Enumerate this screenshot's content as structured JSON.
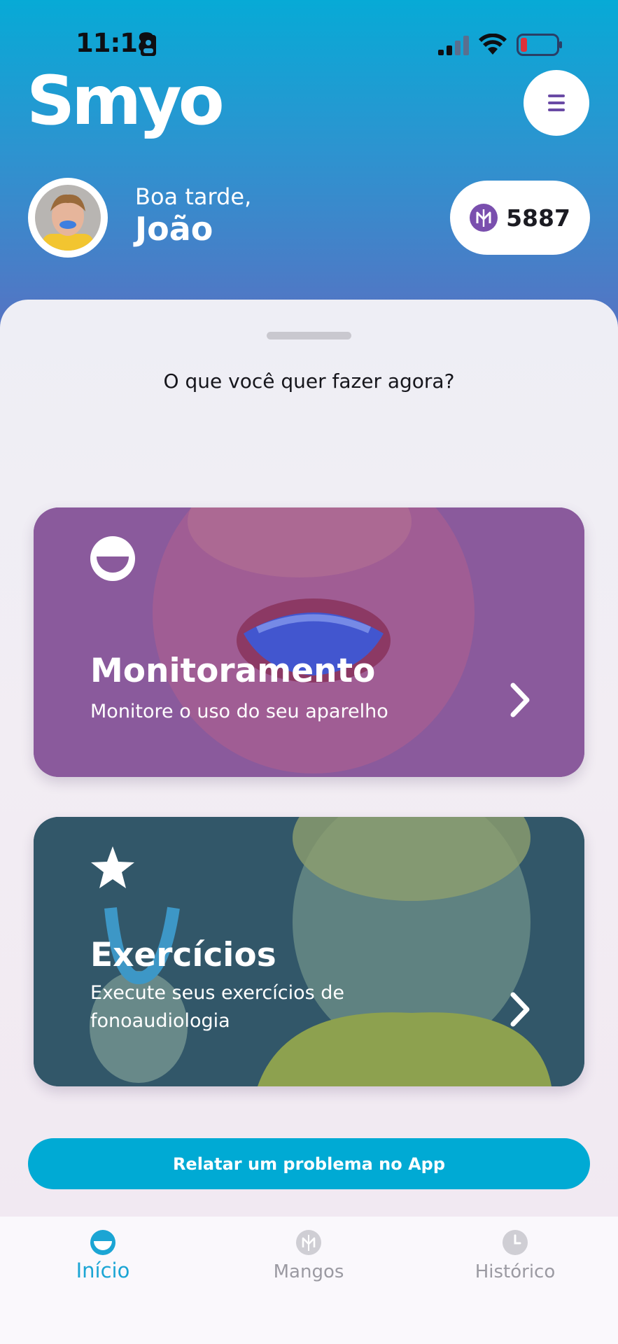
{
  "status_bar": {
    "time": "11:18"
  },
  "header": {
    "logo": "Smyo",
    "menu_icon": "hamburger-menu-icon",
    "greeting": "Boa tarde,",
    "user_name": "João",
    "points": "5887",
    "points_icon": "mango-coin-icon"
  },
  "sheet": {
    "prompt": "O que você quer fazer agora?"
  },
  "cards": {
    "monitoring": {
      "title": "Monitoramento",
      "subtitle": "Monitore o uso do seu aparelho",
      "icon": "smile-icon"
    },
    "exercises": {
      "title": "Exercícios",
      "subtitle": "Execute seus exercícios de fonoaudiologia",
      "icon": "star-icon"
    }
  },
  "report_button": "Relatar um problema no App",
  "bottom_nav": [
    {
      "label": "Início",
      "icon": "smile-icon",
      "active": true
    },
    {
      "label": "Mangos",
      "icon": "mango-coin-icon",
      "active": false
    },
    {
      "label": "Histórico",
      "icon": "clock-icon",
      "active": false
    }
  ],
  "colors": {
    "header_top": "#07aad6",
    "header_bottom": "#5673c3",
    "accent": "#00aad4",
    "points_badge": "#7a4fae",
    "monitoring_card": "#8a5a9c",
    "exercises_card": "#3b6477"
  }
}
